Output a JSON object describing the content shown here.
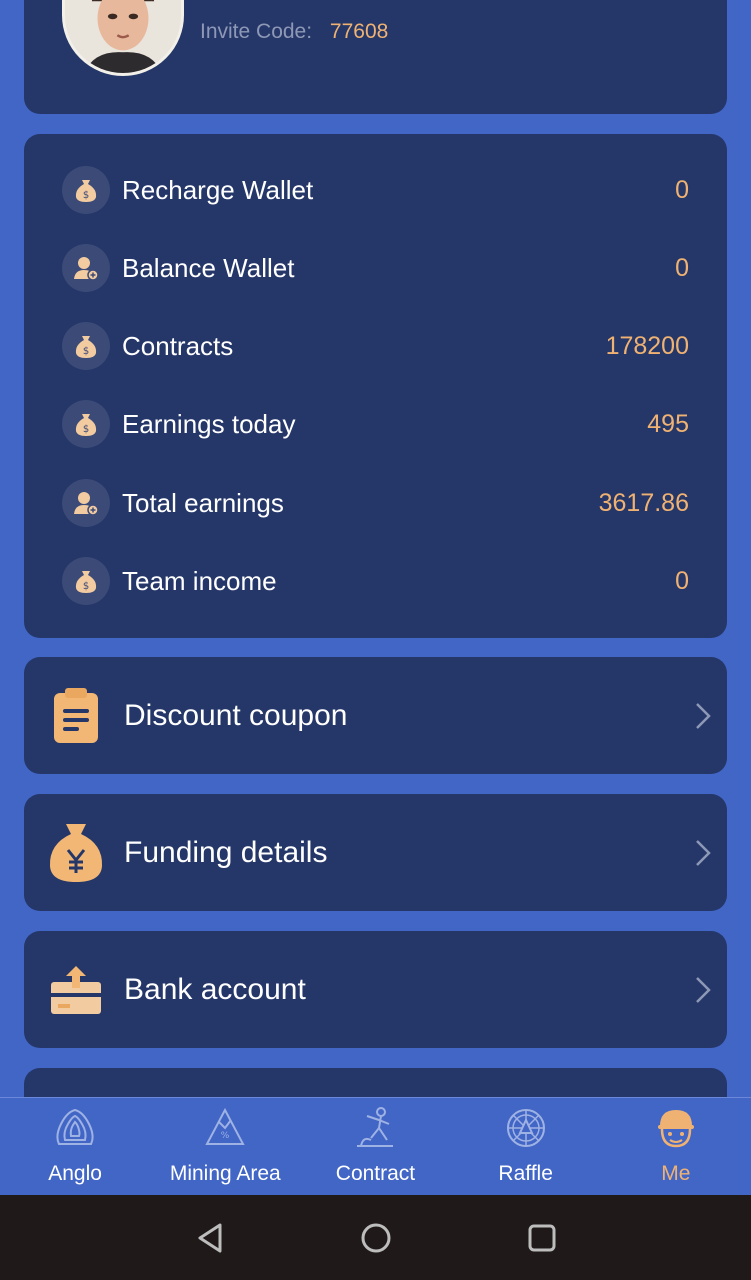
{
  "profile": {
    "invite_label": "Invite Code:",
    "invite_code": "77608"
  },
  "wallets": [
    {
      "label": "Recharge Wallet",
      "value": "0",
      "icon": "money-bag-icon"
    },
    {
      "label": "Balance Wallet",
      "value": "0",
      "icon": "user-add-icon"
    },
    {
      "label": "Contracts",
      "value": "178200",
      "icon": "money-bag-icon"
    },
    {
      "label": "Earnings today",
      "value": "495",
      "icon": "money-bag-icon"
    },
    {
      "label": "Total earnings",
      "value": "3617.86",
      "icon": "user-add-icon"
    },
    {
      "label": "Team income",
      "value": "0",
      "icon": "money-bag-icon"
    }
  ],
  "menu": [
    {
      "label": "Discount coupon",
      "icon": "clipboard-icon"
    },
    {
      "label": "Funding details",
      "icon": "yen-bag-icon"
    },
    {
      "label": "Bank account",
      "icon": "wallet-upload-icon"
    }
  ],
  "tabs": [
    {
      "label": "Anglo",
      "icon": "anglo-logo-icon",
      "active": false
    },
    {
      "label": "Mining Area",
      "icon": "mountain-icon",
      "active": false
    },
    {
      "label": "Contract",
      "icon": "miner-icon",
      "active": false
    },
    {
      "label": "Raffle",
      "icon": "wheel-icon",
      "active": false
    },
    {
      "label": "Me",
      "icon": "helmet-face-icon",
      "active": true
    }
  ],
  "colors": {
    "background": "#4266c6",
    "card": "#253769",
    "accent": "#f0b272",
    "muted": "#8e98b6",
    "system_nav": "#1f1a19"
  }
}
